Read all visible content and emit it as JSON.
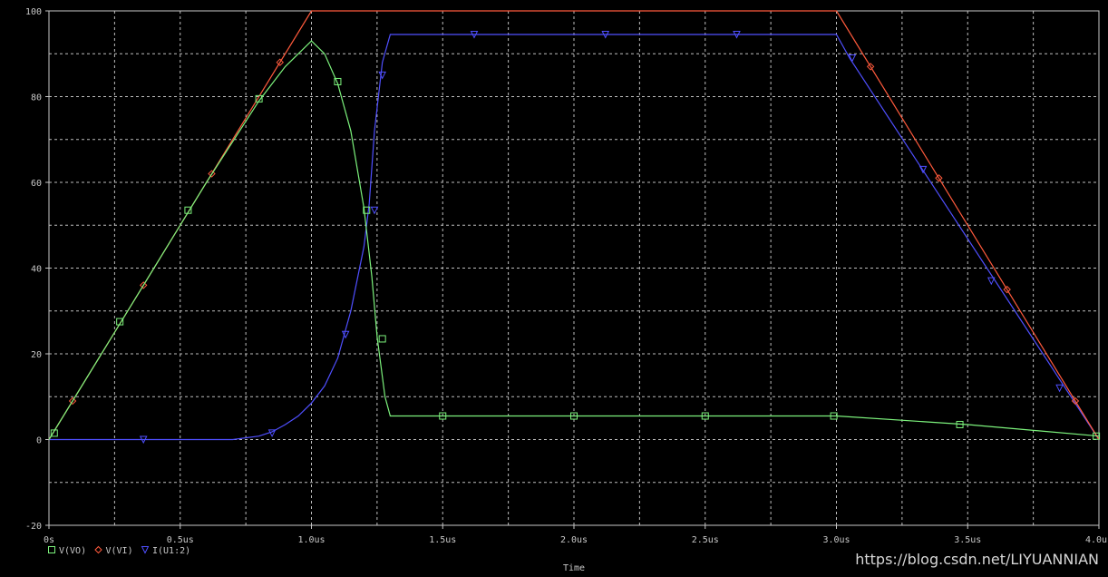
{
  "chart_data": {
    "type": "line",
    "xlabel": "Time",
    "ylabel": "",
    "xlim": [
      0,
      4.0
    ],
    "ylim": [
      -20,
      100
    ],
    "x_ticks": [
      0,
      0.5,
      1.0,
      1.5,
      2.0,
      2.5,
      3.0,
      3.5,
      4.0
    ],
    "x_tick_labels": [
      "0s",
      "0.5us",
      "1.0us",
      "1.5us",
      "2.0us",
      "2.5us",
      "3.0us",
      "3.5us",
      "4.0us"
    ],
    "y_ticks": [
      -20,
      0,
      20,
      40,
      60,
      80,
      100
    ],
    "y_tick_labels": [
      "-20",
      "0",
      "20",
      "40",
      "60",
      "80",
      "100"
    ],
    "grid": true,
    "background": "#000000",
    "legend_placement": "bottom-left",
    "series": [
      {
        "name": "V(VO)",
        "color": "#7cf27c",
        "marker": "square",
        "x": [
          0.0,
          0.2,
          0.4,
          0.6,
          0.8,
          0.9,
          1.0,
          1.05,
          1.1,
          1.15,
          1.2,
          1.23,
          1.25,
          1.28,
          1.3,
          1.5,
          2.0,
          2.5,
          3.0,
          3.5,
          4.0
        ],
        "y": [
          0,
          20,
          40,
          60,
          79,
          87,
          93,
          90,
          83,
          72,
          54,
          38,
          24,
          10,
          5.5,
          5.5,
          5.5,
          5.5,
          5.5,
          3.5,
          0.8
        ],
        "marker_x": [
          0.02,
          0.27,
          0.53,
          0.8,
          1.1,
          1.21,
          1.27,
          1.5,
          2.0,
          2.5,
          2.99,
          3.47,
          3.99
        ],
        "marker_y": [
          1.5,
          27.5,
          53.5,
          79.5,
          83.5,
          53.5,
          23.5,
          5.5,
          5.5,
          5.5,
          5.5,
          3.5,
          0.8
        ]
      },
      {
        "name": "V(VI)",
        "color": "#ff5a3c",
        "marker": "diamond",
        "x": [
          0.0,
          1.0,
          3.0,
          4.0
        ],
        "y": [
          0,
          100,
          100,
          0
        ],
        "marker_x": [
          0.09,
          0.36,
          0.62,
          0.88,
          3.13,
          3.39,
          3.65,
          3.91
        ],
        "marker_y": [
          9,
          36,
          62,
          88,
          87,
          61,
          35,
          9
        ]
      },
      {
        "name": "I(U1:2)",
        "color": "#4f4fff",
        "marker": "triangle",
        "x": [
          0.0,
          0.7,
          0.8,
          0.85,
          0.9,
          0.95,
          1.0,
          1.05,
          1.1,
          1.15,
          1.2,
          1.22,
          1.24,
          1.27,
          1.3,
          2.0,
          3.0,
          3.05,
          4.0
        ],
        "y": [
          0,
          0,
          0.8,
          1.8,
          3.5,
          5.5,
          8.5,
          12.5,
          19,
          30,
          45,
          55,
          72,
          88,
          94.5,
          94.5,
          94.5,
          89,
          0
        ],
        "marker_x": [
          0.36,
          0.85,
          1.13,
          1.24,
          1.27,
          1.62,
          2.12,
          2.62,
          3.06,
          3.33,
          3.59,
          3.85
        ],
        "marker_y": [
          0,
          1.5,
          24.5,
          53.5,
          85,
          94.5,
          94.5,
          94.5,
          89,
          63,
          37,
          12
        ]
      }
    ]
  },
  "watermark": "https://blog.csdn.net/LIYUANNIAN"
}
